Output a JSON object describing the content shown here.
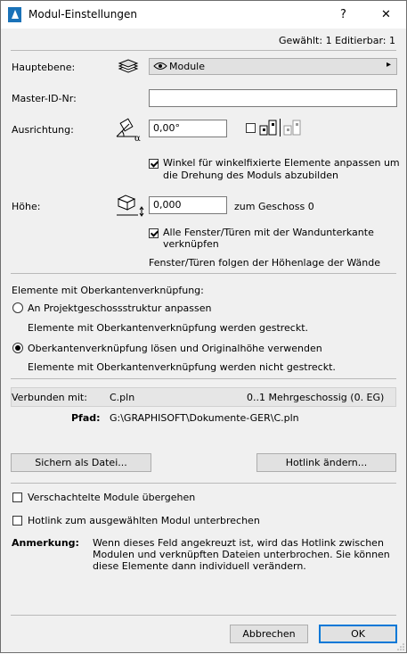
{
  "window": {
    "title": "Modul-Einstellungen",
    "help_label": "?",
    "close_label": "✕"
  },
  "header": {
    "selection_info": "Gewählt: 1 Editierbar: 1"
  },
  "hauptebene": {
    "label": "Hauptebene:",
    "value": "Module",
    "arrow": "▸"
  },
  "master_id": {
    "label": "Master-ID-Nr:",
    "value": ""
  },
  "ausrichtung": {
    "label": "Ausrichtung:",
    "value": "0,00°",
    "checkbox_adjust_label_line1": "Winkel für winkelfixierte Elemente anpassen um",
    "checkbox_adjust_label_line2": "die Drehung des Moduls abzubilden"
  },
  "hoehe": {
    "label": "Höhe:",
    "value": "0,000",
    "suffix": "zum Geschoss 0",
    "checkbox_doors_line1": "Alle Fenster/Türen mit der Wandunterkante",
    "checkbox_doors_line2": "verknüpfen",
    "doors_note": "Fenster/Türen folgen der Höhenlage der Wände"
  },
  "oberkante": {
    "heading": "Elemente mit Oberkantenverknüpfung:",
    "option1_label": "An Projektgeschossstruktur anpassen",
    "option1_desc": "Elemente mit Oberkantenverknüpfung werden gestreckt.",
    "option2_label": "Oberkantenverknüpfung lösen und Originalhöhe verwenden",
    "option2_desc": "Elemente mit Oberkantenverknüpfung werden nicht gestreckt."
  },
  "link": {
    "connected_label": "Verbunden mit:",
    "file": "C.pln",
    "story": "0..1 Mehrgeschossig (0. EG)",
    "path_label": "Pfad:",
    "path": "G:\\GRAPHISOFT\\Dokumente-GER\\C.pln"
  },
  "buttons": {
    "save_as": "Sichern als Datei...",
    "change_hotlink": "Hotlink ändern...",
    "cancel": "Abbrechen",
    "ok": "OK"
  },
  "options": {
    "skip_nested": "Verschachtelte Module übergehen",
    "break_hotlink": "Hotlink zum ausgewählten Modul unterbrechen"
  },
  "note": {
    "label": "Anmerkung:",
    "line1": "Wenn dieses Feld angekreuzt ist, wird das Hotlink zwischen",
    "line2": "Modulen und verknüpften Dateien unterbrochen. Sie können",
    "line3": "diese Elemente dann individuell verändern."
  },
  "colors": {
    "accent": "#0078d7",
    "dialog_bg": "#f0f0f0"
  }
}
